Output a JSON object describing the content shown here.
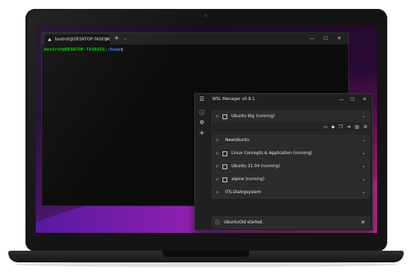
{
  "terminal": {
    "tab_title": "bostrot@DESKTOP-TASEQIG: /h",
    "prompt_user": "bostrot@DESKTOP-TASEQIG",
    "prompt_sep": ":",
    "prompt_path": "/home",
    "prompt_dollar": "$"
  },
  "wsl_manager": {
    "title": "WSL Manager v0.9.1",
    "distros": [
      {
        "name": "Ubuntu Big (running)",
        "has_stop": true
      },
      {
        "name": "NewUbuntu",
        "has_stop": false
      },
      {
        "name": "Linux Concepts & Application (running)",
        "has_stop": true
      },
      {
        "name": "Ubuntu 21.04 (running)",
        "has_stop": true
      },
      {
        "name": "alpine (running)",
        "has_stop": true
      },
      {
        "name": "ITS-Dialogsystem",
        "has_stop": false
      }
    ],
    "status_message": "UbuntuOld started."
  },
  "icons": {
    "play": "▷",
    "chevron": "⌄",
    "minimize": "—",
    "maximize": "☐",
    "close": "✕"
  },
  "colors": {
    "prompt_user": "#16c60c",
    "prompt_path": "#3b78ff",
    "window_bg": "#202020",
    "wallpaper_accent": "#c21a8c"
  }
}
